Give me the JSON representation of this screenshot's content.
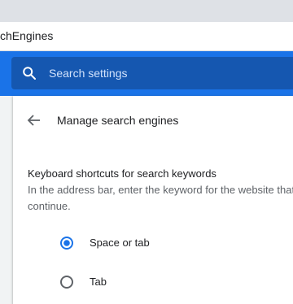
{
  "browser": {
    "url_text": "chEngines"
  },
  "header": {
    "search": {
      "placeholder": "Search settings",
      "icon": "search-icon"
    }
  },
  "subpage": {
    "back_icon": "arrow-back-icon",
    "title": "Manage search engines"
  },
  "keyboard_shortcuts": {
    "heading": "Keyboard shortcuts for search keywords",
    "description_line1": "In the address bar, enter the keyword for the website that",
    "description_line2": "continue.",
    "options": [
      {
        "label": "Space or tab",
        "selected": true
      },
      {
        "label": "Tab",
        "selected": false
      }
    ]
  },
  "colors": {
    "accent": "#1a73e8",
    "search_box": "#1557b0",
    "radio_unselected": "#5f6368"
  }
}
